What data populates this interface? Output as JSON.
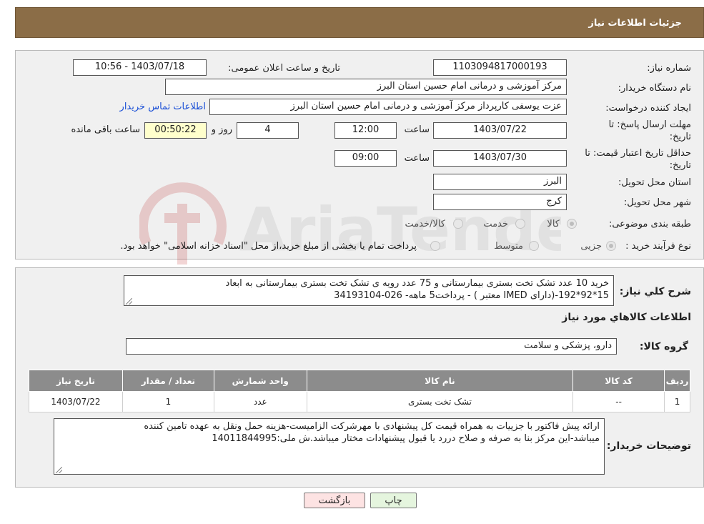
{
  "header": {
    "title": "جزئیات اطلاعات نیاز"
  },
  "form": {
    "need_number": {
      "label": "شماره نیاز:",
      "value": "1103094817000193"
    },
    "announce_datetime": {
      "label": "تاریخ و ساعت اعلان عمومی:",
      "value": "1403/07/18 - 10:56"
    },
    "buyer_org": {
      "label": "نام دستگاه خریدار:",
      "value": "مرکز آموزشی و درمانی امام حسین استان البرز"
    },
    "requester": {
      "label": "ایجاد کننده درخواست:",
      "value": "عزت یوسفی کارپرداز مرکز آموزشی و درمانی امام حسین استان البرز",
      "contact_link": "اطلاعات تماس خریدار"
    },
    "reply_deadline": {
      "label": "مهلت ارسال پاسخ: تا تاریخ:",
      "date": "1403/07/22",
      "time_label": "ساعت",
      "time": "12:00",
      "days": "4",
      "days_label": "روز و",
      "remaining": "00:50:22",
      "remaining_label": "ساعت باقی مانده"
    },
    "price_validity": {
      "label": "حداقل تاریخ اعتبار قیمت: تا تاریخ:",
      "date": "1403/07/30",
      "time_label": "ساعت",
      "time": "09:00"
    },
    "province": {
      "label": "استان محل تحویل:",
      "value": "البرز"
    },
    "city": {
      "label": "شهر محل تحویل:",
      "value": "کرج"
    },
    "category": {
      "label": "طبقه بندی موضوعی:",
      "options": [
        "کالا",
        "خدمت",
        "کالا/خدمت"
      ]
    },
    "process": {
      "label": "نوع فرآیند خرید :",
      "options": [
        "جزیی",
        "متوسط"
      ],
      "note": "پرداخت تمام یا بخشی از مبلغ خرید،از محل \"اسناد خزانه اسلامی\" خواهد بود."
    }
  },
  "summary": {
    "label": "شرح کلي نياز:",
    "line1": "خرید 10 عدد تشک تخت بستری بیمارستانی و 75 عدد رویه ی تشک تخت بستری بیمارستانی به ابعاد",
    "line2": "15*92*192-(دارای IMED  معتبر ) - پرداخت5 ماهه- 026-34193104"
  },
  "goods_info_title": "اطلاعات کالاهاي مورد نياز",
  "goods_group": {
    "label": "گروه کالا:",
    "value": "دارو، پزشکی و سلامت"
  },
  "table": {
    "headers": [
      "ردیف",
      "کد کالا",
      "نام کالا",
      "واحد شمارش",
      "تعداد / مقدار",
      "تاریخ نیاز"
    ],
    "rows": [
      [
        "1",
        "--",
        "تشک تخت بستری",
        "عدد",
        "1",
        "1403/07/22"
      ]
    ]
  },
  "buyer_notes": {
    "label": "توضیحات خریدار:",
    "line1": "ارائه پیش فاکتور با جزییات به همراه قیمت کل پیشنهادی با مهرشرکت الزامیست-هزینه حمل ونقل به عهده تامین کننده",
    "line2": "میباشد-این مرکز بنا به صرفه و صلاح دررد یا قبول پیشنهادات مختار میباشد.ش ملی:14011844995"
  },
  "buttons": {
    "print": "چاپ",
    "back": "بازگشت"
  },
  "watermark": {
    "text": "AriaTender.neT"
  },
  "colors": {
    "header_bg": "#8b6d47",
    "table_header_bg": "#8c8c8c",
    "back_button_bg": "#fde3e3",
    "print_button_bg": "#e5f5de"
  }
}
